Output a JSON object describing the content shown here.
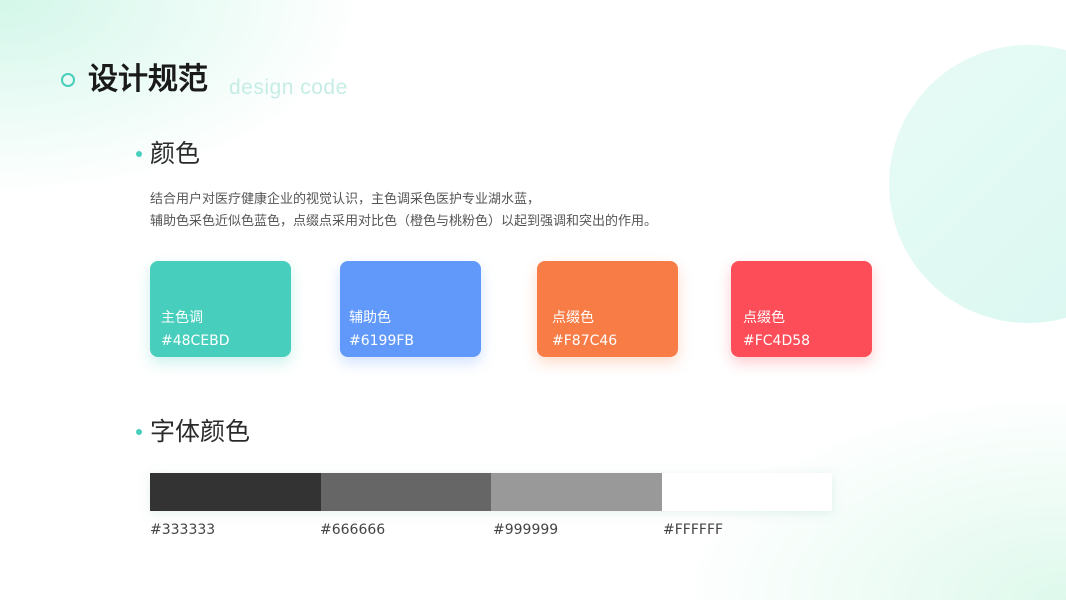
{
  "page": {
    "title": "设计规范",
    "subtitle": "design code"
  },
  "color_section": {
    "heading": "颜色",
    "description_lines": [
      "结合用户对医疗健康企业的视觉认识，主色调采色医护专业湖水蓝，",
      "辅助色采色近似色蓝色，点缀点采用对比色（橙色与桃粉色）以起到强调和突出的作用。"
    ],
    "swatches": [
      {
        "name": "主色调",
        "hex": "#48CEBD",
        "color": "#48CEBD"
      },
      {
        "name": "辅助色",
        "hex": "#6199FB",
        "color": "#6199FB"
      },
      {
        "name": "点缀色",
        "hex": "#F87C46",
        "color": "#F87C46"
      },
      {
        "name": "点缀色",
        "hex": "#FC4D58",
        "color": "#FC4D58"
      }
    ]
  },
  "font_section": {
    "heading": "字体颜色",
    "colors": [
      {
        "hex": "#333333",
        "color": "#333333"
      },
      {
        "hex": "#666666",
        "color": "#666666"
      },
      {
        "hex": "#999999",
        "color": "#999999"
      },
      {
        "hex": "#FFFFFF",
        "color": "#FFFFFF"
      }
    ]
  },
  "theme": {
    "accent": "#48CEBD"
  }
}
